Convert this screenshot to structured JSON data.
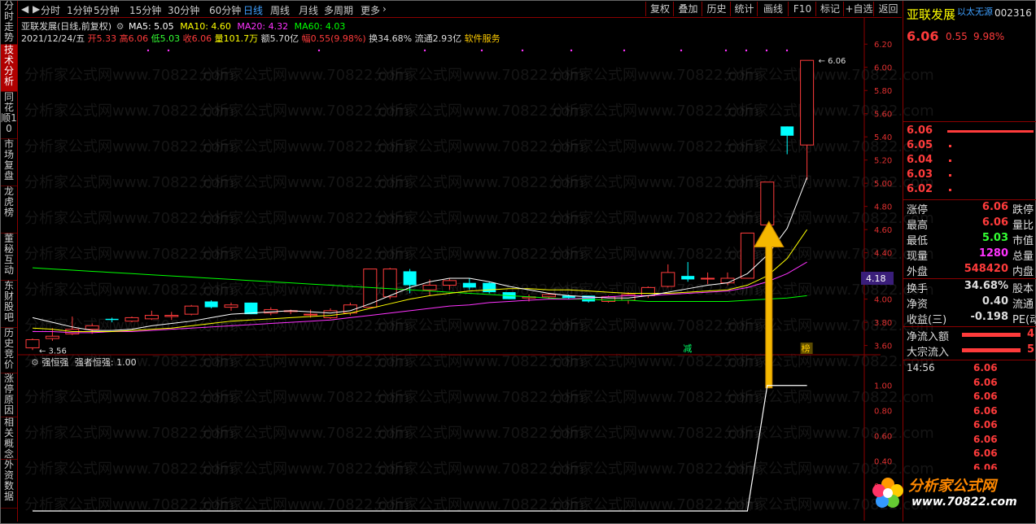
{
  "left_nav": [
    {
      "label": "分时走势",
      "active": false
    },
    {
      "label": "技术分析",
      "active": true
    },
    {
      "label": "同花顺10",
      "active": false
    },
    {
      "label": "市场复盘",
      "active": false
    },
    {
      "label": "龙虎榜",
      "active": false
    },
    {
      "label": "董秘互动",
      "active": false
    },
    {
      "label": "东财股吧",
      "active": false
    },
    {
      "label": "历史竞价",
      "active": false
    },
    {
      "label": "涨停原因",
      "active": false
    },
    {
      "label": "相关概念",
      "active": false
    },
    {
      "label": "外资数据",
      "active": false
    }
  ],
  "toolbar": {
    "back_icon": "left-arrow",
    "fwd_icon": "right-arrow",
    "periods": [
      "分时",
      "1分钟",
      "5分钟",
      "15分钟",
      "30分钟",
      "60分钟",
      "日线",
      "周线",
      "月线",
      "多周期",
      "更多"
    ],
    "active_period": "日线",
    "more_icon": "chevron-right",
    "right_buttons": [
      "复权",
      "叠加",
      "历史",
      "统计",
      "画线",
      "F10",
      "标记",
      "+自选",
      "返回"
    ]
  },
  "stock": {
    "name": "亚联发展",
    "mode": "(日线,前复权)",
    "code": "002316",
    "concept": "以太无源"
  },
  "ma_line": {
    "ma5": "MA5: 5.05",
    "ma10": "MA10: 4.60",
    "ma20": "MA20: 4.32",
    "ma60": "MA60: 4.03",
    "colors": {
      "ma5": "#ffffff",
      "ma10": "#ffff00",
      "ma20": "#ff33ff",
      "ma60": "#00ff00"
    }
  },
  "day_line": {
    "date": "2021/12/24/五",
    "open": "开5.33",
    "high": "高6.06",
    "low": "低5.03",
    "close": "收6.06",
    "volume": "量101.7万",
    "amount": "额5.70亿",
    "range": "幅0.55(9.98%)",
    "turnover": "换34.68%",
    "float": "流通2.93亿",
    "industry": "软件服务"
  },
  "price_axis": [
    "6.20",
    "6.00",
    "5.80",
    "5.60",
    "5.40",
    "5.20",
    "5.00",
    "4.80",
    "4.60",
    "4.40",
    "4.20",
    "4.00",
    "3.80",
    "3.60"
  ],
  "price_marker": "4.18",
  "hi_label": "6.06",
  "lo_label": "3.56",
  "badges": {
    "jian": "减",
    "bang": "榜"
  },
  "indicator": {
    "title": "强恒强",
    "value": "强者恒强: 1.00",
    "axis": [
      "1.00",
      "0.80",
      "0.60",
      "0.40",
      "0.20"
    ]
  },
  "right_panel": {
    "price": "6.06",
    "change": "0.55",
    "pct": "9.98%",
    "orders": [
      "6.06",
      "6.05",
      "6.04",
      "6.03",
      "6.02"
    ],
    "stats": [
      {
        "l": "涨停",
        "v": "6.06",
        "r": "跌停",
        "vc": "#ff3b3b"
      },
      {
        "l": "最高",
        "v": "6.06",
        "r": "量比",
        "vc": "#ff3b3b"
      },
      {
        "l": "最低",
        "v": "5.03",
        "r": "市值",
        "vc": "#33ff33"
      },
      {
        "l": "现量",
        "v": "1280",
        "r": "总量",
        "vc": "#ff33ff"
      },
      {
        "l": "外盘",
        "v": "548420",
        "r": "内盘",
        "vc": "#ff3b3b"
      }
    ],
    "stats2": [
      {
        "l": "换手",
        "v": "34.68%",
        "r": "股本"
      },
      {
        "l": "净资",
        "v": "0.40",
        "r": "流通"
      },
      {
        "l": "收益(三)",
        "v": "-0.198",
        "r": "PE(动"
      }
    ],
    "flows": [
      {
        "l": "净流入额",
        "v": "4"
      },
      {
        "l": "大宗流入",
        "v": "5"
      }
    ],
    "tick_time": "14:56",
    "ticks": [
      "6.06",
      "6.06",
      "6.06",
      "6.06",
      "6.06",
      "6.06",
      "6.06",
      "6.06"
    ]
  },
  "watermark": {
    "text": "分析家公式网www.70822.com",
    "logo": "分析家公式网",
    "url": "www.70822.com"
  },
  "candles": [
    {
      "o": 3.58,
      "c": 3.65,
      "h": 3.66,
      "l": 3.56
    },
    {
      "o": 3.66,
      "c": 3.68,
      "h": 3.75,
      "l": 3.64
    },
    {
      "o": 3.7,
      "c": 3.74,
      "h": 3.85,
      "l": 3.69
    },
    {
      "o": 3.74,
      "c": 3.77,
      "h": 3.79,
      "l": 3.7
    },
    {
      "o": 3.83,
      "c": 3.82,
      "h": 3.84,
      "l": 3.8
    },
    {
      "o": 3.81,
      "c": 3.84,
      "h": 3.85,
      "l": 3.8
    },
    {
      "o": 3.83,
      "c": 3.86,
      "h": 3.9,
      "l": 3.82
    },
    {
      "o": 3.85,
      "c": 3.86,
      "h": 3.89,
      "l": 3.82
    },
    {
      "o": 3.87,
      "c": 3.94,
      "h": 3.95,
      "l": 3.86
    },
    {
      "o": 3.98,
      "c": 3.93,
      "h": 3.99,
      "l": 3.92
    },
    {
      "o": 3.93,
      "c": 3.95,
      "h": 3.97,
      "l": 3.9
    },
    {
      "o": 3.97,
      "c": 3.87,
      "h": 3.97,
      "l": 3.87
    },
    {
      "o": 3.88,
      "c": 3.91,
      "h": 3.93,
      "l": 3.86
    },
    {
      "o": 3.9,
      "c": 3.9,
      "h": 3.91,
      "l": 3.87
    },
    {
      "o": 3.87,
      "c": 3.87,
      "h": 3.91,
      "l": 3.84
    },
    {
      "o": 3.84,
      "c": 3.9,
      "h": 3.92,
      "l": 3.83
    },
    {
      "o": 3.88,
      "c": 3.95,
      "h": 3.97,
      "l": 3.86
    },
    {
      "o": 3.93,
      "c": 4.26,
      "h": 4.26,
      "l": 3.93
    },
    {
      "o": 4.02,
      "c": 4.26,
      "h": 4.27,
      "l": 4.0
    },
    {
      "o": 4.24,
      "c": 4.12,
      "h": 4.26,
      "l": 4.05
    },
    {
      "o": 4.08,
      "c": 4.12,
      "h": 4.17,
      "l": 4.03
    },
    {
      "o": 4.12,
      "c": 4.16,
      "h": 4.18,
      "l": 4.08
    },
    {
      "o": 4.14,
      "c": 4.1,
      "h": 4.18,
      "l": 4.08
    },
    {
      "o": 4.14,
      "c": 4.06,
      "h": 4.15,
      "l": 4.05
    },
    {
      "o": 4.06,
      "c": 4.0,
      "h": 4.06,
      "l": 4.0
    },
    {
      "o": 4.01,
      "c": 4.02,
      "h": 4.04,
      "l": 3.98
    },
    {
      "o": 4.02,
      "c": 4.04,
      "h": 4.05,
      "l": 4.0
    },
    {
      "o": 4.03,
      "c": 4.01,
      "h": 4.04,
      "l": 4.0
    },
    {
      "o": 4.03,
      "c": 3.98,
      "h": 4.03,
      "l": 3.97
    },
    {
      "o": 3.98,
      "c": 4.02,
      "h": 4.03,
      "l": 3.97
    },
    {
      "o": 3.99,
      "c": 4.04,
      "h": 4.06,
      "l": 3.96
    },
    {
      "o": 4.03,
      "c": 4.1,
      "h": 4.11,
      "l": 4.01
    },
    {
      "o": 4.11,
      "c": 4.23,
      "h": 4.3,
      "l": 4.1
    },
    {
      "o": 4.2,
      "c": 4.17,
      "h": 4.32,
      "l": 4.15
    },
    {
      "o": 4.18,
      "c": 4.18,
      "h": 4.23,
      "l": 4.13
    },
    {
      "o": 4.14,
      "c": 4.18,
      "h": 4.23,
      "l": 4.12
    },
    {
      "o": 4.18,
      "c": 4.57,
      "h": 4.57,
      "l": 4.18
    },
    {
      "o": 4.64,
      "c": 5.01,
      "h": 5.01,
      "l": 4.61
    },
    {
      "o": 5.49,
      "c": 5.41,
      "h": 5.49,
      "l": 5.25
    },
    {
      "o": 5.33,
      "c": 6.06,
      "h": 6.06,
      "l": 5.03
    }
  ],
  "ma_series": {
    "ma5": [
      3.84,
      3.8,
      3.76,
      3.73,
      3.73,
      3.74,
      3.77,
      3.79,
      3.81,
      3.84,
      3.87,
      3.88,
      3.89,
      3.9,
      3.89,
      3.88,
      3.9,
      3.96,
      4.03,
      4.1,
      4.15,
      4.18,
      4.18,
      4.15,
      4.11,
      4.08,
      4.05,
      4.03,
      4.02,
      4.01,
      4.01,
      4.03,
      4.06,
      4.09,
      4.12,
      4.14,
      4.22,
      4.38,
      4.61,
      5.05
    ],
    "ma10": [
      3.75,
      3.74,
      3.72,
      3.72,
      3.72,
      3.73,
      3.74,
      3.75,
      3.77,
      3.79,
      3.81,
      3.82,
      3.83,
      3.84,
      3.85,
      3.86,
      3.88,
      3.92,
      3.96,
      4.0,
      4.03,
      4.05,
      4.07,
      4.08,
      4.09,
      4.09,
      4.08,
      4.08,
      4.07,
      4.06,
      4.05,
      4.05,
      4.05,
      4.06,
      4.07,
      4.08,
      4.12,
      4.2,
      4.35,
      4.6
    ],
    "ma20": [
      3.72,
      3.72,
      3.71,
      3.71,
      3.72,
      3.72,
      3.73,
      3.74,
      3.75,
      3.76,
      3.77,
      3.78,
      3.79,
      3.8,
      3.81,
      3.82,
      3.84,
      3.86,
      3.88,
      3.9,
      3.92,
      3.94,
      3.95,
      3.97,
      3.98,
      3.99,
      4.0,
      4.0,
      4.01,
      4.02,
      4.03,
      4.03,
      4.04,
      4.05,
      4.06,
      4.07,
      4.1,
      4.15,
      4.22,
      4.32
    ],
    "ma60": [
      4.27,
      4.26,
      4.25,
      4.24,
      4.23,
      4.22,
      4.21,
      4.2,
      4.19,
      4.18,
      4.17,
      4.16,
      4.15,
      4.14,
      4.13,
      4.12,
      4.11,
      4.1,
      4.09,
      4.08,
      4.07,
      4.06,
      4.05,
      4.04,
      4.03,
      4.02,
      4.01,
      4.0,
      4.0,
      3.99,
      3.99,
      3.98,
      3.98,
      3.98,
      3.98,
      3.98,
      3.99,
      4.0,
      4.01,
      4.03
    ]
  },
  "indicator_values": [
    0,
    0,
    0,
    0,
    0,
    0,
    0,
    0,
    0,
    0,
    0,
    0,
    0,
    0,
    0,
    0,
    0,
    0,
    0,
    0,
    0,
    0,
    0,
    0,
    0,
    0,
    0,
    0,
    0,
    0,
    0,
    0,
    0,
    0,
    0,
    0,
    0,
    1.0,
    1.0,
    1.0
  ]
}
